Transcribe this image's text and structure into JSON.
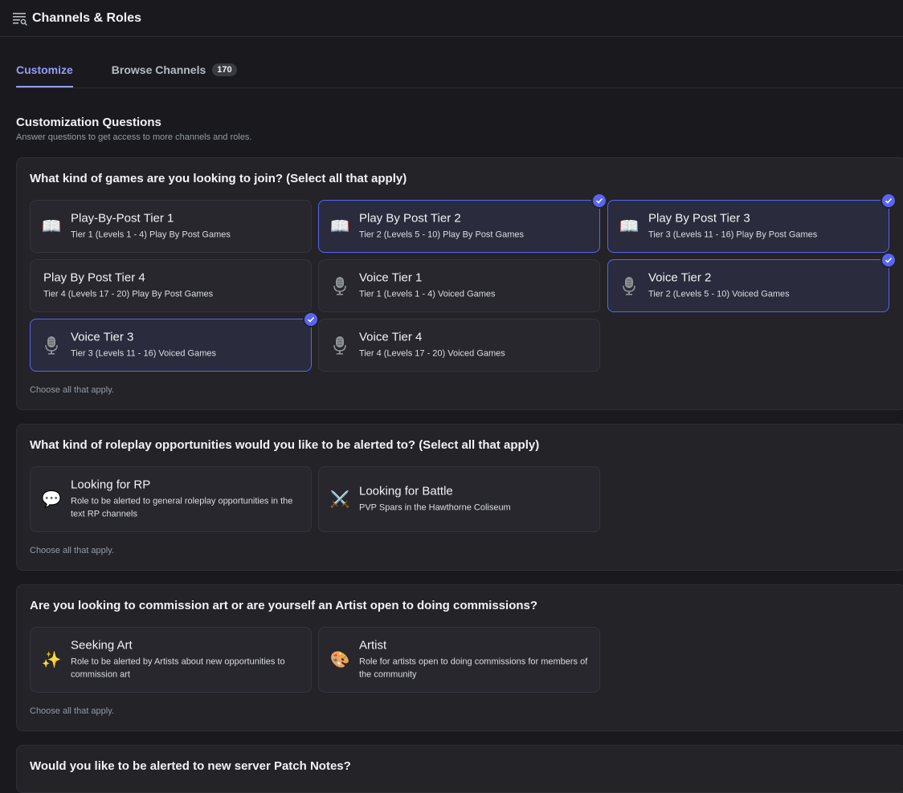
{
  "header": {
    "title": "Channels & Roles",
    "icon": "channels-list-icon"
  },
  "tabs": {
    "customize": "Customize",
    "browse": "Browse Channels",
    "browse_count": "170"
  },
  "section": {
    "title": "Customization Questions",
    "subtitle": "Answer questions to get access to more channels and roles."
  },
  "questions": [
    {
      "title": "What kind of games are you looking to join? (Select all that apply)",
      "hint": "Choose all that apply.",
      "options": [
        {
          "name": "Play-By-Post Tier 1",
          "desc": "Tier 1 (Levels 1 - 4) Play By Post Games",
          "icon": "📖",
          "selected": false
        },
        {
          "name": "Play By Post Tier 2",
          "desc": "Tier 2 (Levels 5 - 10) Play By Post Games",
          "icon": "📖",
          "selected": true
        },
        {
          "name": "Play By Post Tier 3",
          "desc": "Tier 3 (Levels 11 - 16) Play By Post Games",
          "icon": "📖",
          "selected": true
        },
        {
          "name": "Play By Post Tier 4",
          "desc": "Tier 4 (Levels 17 - 20) Play By Post Games",
          "icon": "",
          "selected": false
        },
        {
          "name": "Voice Tier 1",
          "desc": "Tier 1 (Levels 1 - 4) Voiced Games",
          "icon": "microphone-icon",
          "selected": false
        },
        {
          "name": "Voice Tier 2",
          "desc": "Tier 2 (Levels 5 - 10) Voiced Games",
          "icon": "microphone-icon",
          "selected": true
        },
        {
          "name": "Voice Tier 3",
          "desc": "Tier 3 (Levels 11 - 16) Voiced Games",
          "icon": "microphone-icon",
          "selected": true
        },
        {
          "name": "Voice Tier 4",
          "desc": "Tier 4 (Levels 17 - 20) Voiced Games",
          "icon": "microphone-icon",
          "selected": false
        }
      ]
    },
    {
      "title": "What kind of roleplay opportunities would you like to be alerted to? (Select all that apply)",
      "hint": "Choose all that apply.",
      "options": [
        {
          "name": "Looking for RP",
          "desc": "Role to be alerted to general roleplay opportunities in the text RP channels",
          "icon": "💬",
          "selected": false
        },
        {
          "name": "Looking for Battle",
          "desc": "PVP Spars in the Hawthorne Coliseum",
          "icon": "⚔️",
          "selected": false
        }
      ]
    },
    {
      "title": "Are you looking to commission art or are yourself an Artist open to doing commissions?",
      "hint": "Choose all that apply.",
      "options": [
        {
          "name": "Seeking Art",
          "desc": "Role to be alerted by Artists about new opportunities to commission art",
          "icon": "✨",
          "selected": false
        },
        {
          "name": "Artist",
          "desc": "Role for artists open to doing commissions for members of the community",
          "icon": "🎨",
          "selected": false
        }
      ]
    },
    {
      "title": "Would you like to be alerted to new server Patch Notes?"
    }
  ]
}
